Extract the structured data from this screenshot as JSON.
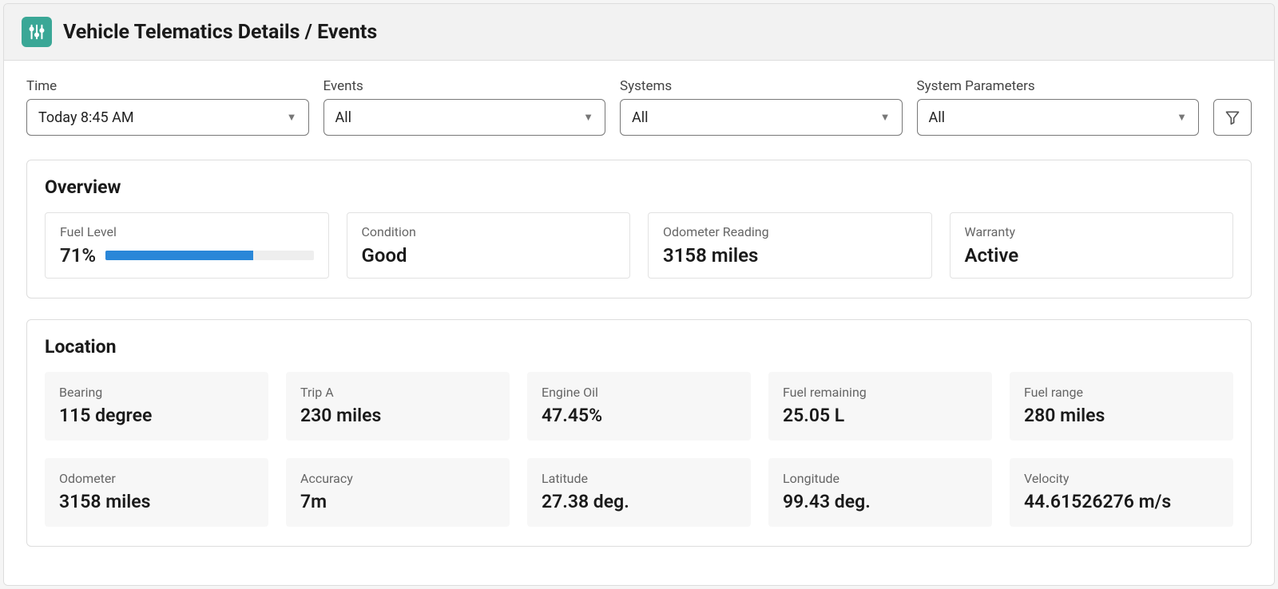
{
  "header": {
    "title": "Vehicle Telematics Details / Events"
  },
  "filters": {
    "time": {
      "label": "Time",
      "value": "Today 8:45 AM"
    },
    "events": {
      "label": "Events",
      "value": "All"
    },
    "systems": {
      "label": "Systems",
      "value": "All"
    },
    "params": {
      "label": "System Parameters",
      "value": "All"
    }
  },
  "overview": {
    "title": "Overview",
    "fuel": {
      "label": "Fuel Level",
      "pct_text": "71%",
      "pct": 71
    },
    "condition": {
      "label": "Condition",
      "value": "Good"
    },
    "odometer": {
      "label": "Odometer  Reading",
      "value": "3158 miles"
    },
    "warranty": {
      "label": "Warranty",
      "value": "Active"
    }
  },
  "location": {
    "title": "Location",
    "bearing": {
      "label": "Bearing",
      "value": "115 degree"
    },
    "trip_a": {
      "label": "Trip A",
      "value": "230 miles"
    },
    "engine_oil": {
      "label": "Engine Oil",
      "value": "47.45%"
    },
    "fuel_rem": {
      "label": "Fuel remaining",
      "value": "25.05 L"
    },
    "fuel_range": {
      "label": "Fuel range",
      "value": "280 miles"
    },
    "odometer": {
      "label": "Odometer",
      "value": "3158 miles"
    },
    "accuracy": {
      "label": "Accuracy",
      "value": "7m"
    },
    "latitude": {
      "label": "Latitude",
      "value": "27.38 deg."
    },
    "longitude": {
      "label": "Longitude",
      "value": "99.43 deg."
    },
    "velocity": {
      "label": "Velocity",
      "value": "44.61526276 m/s"
    }
  }
}
